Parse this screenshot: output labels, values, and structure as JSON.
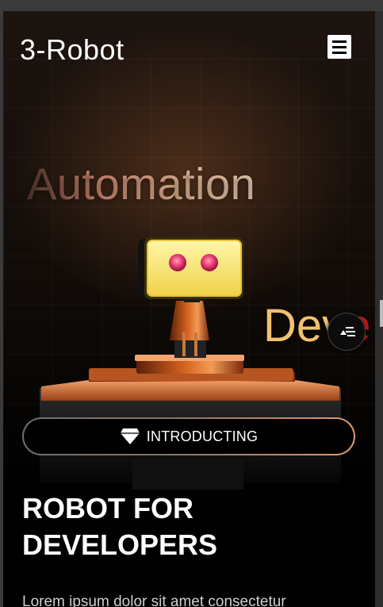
{
  "app": {
    "brand": "3-Robot",
    "menu_icon": "hamburger-menu-icon"
  },
  "hero": {
    "word_primary": "Automation",
    "word_secondary_visible": "Dev",
    "word_secondary_red": "e",
    "intro_label": "INTRODUCTING",
    "intro_icon": "diamond-icon",
    "fab_icon": "sort-list-icon"
  },
  "content": {
    "headline_line1": "ROBOT FOR",
    "headline_line2": "DEVELOPERS",
    "body_text": "Lorem ipsum dolor sit amet consectetur"
  },
  "colors": {
    "page_bg": "#000000",
    "accent_orange": "#e39b6e",
    "accent_gold": "#f2c170",
    "accent_red": "#d8191b"
  }
}
